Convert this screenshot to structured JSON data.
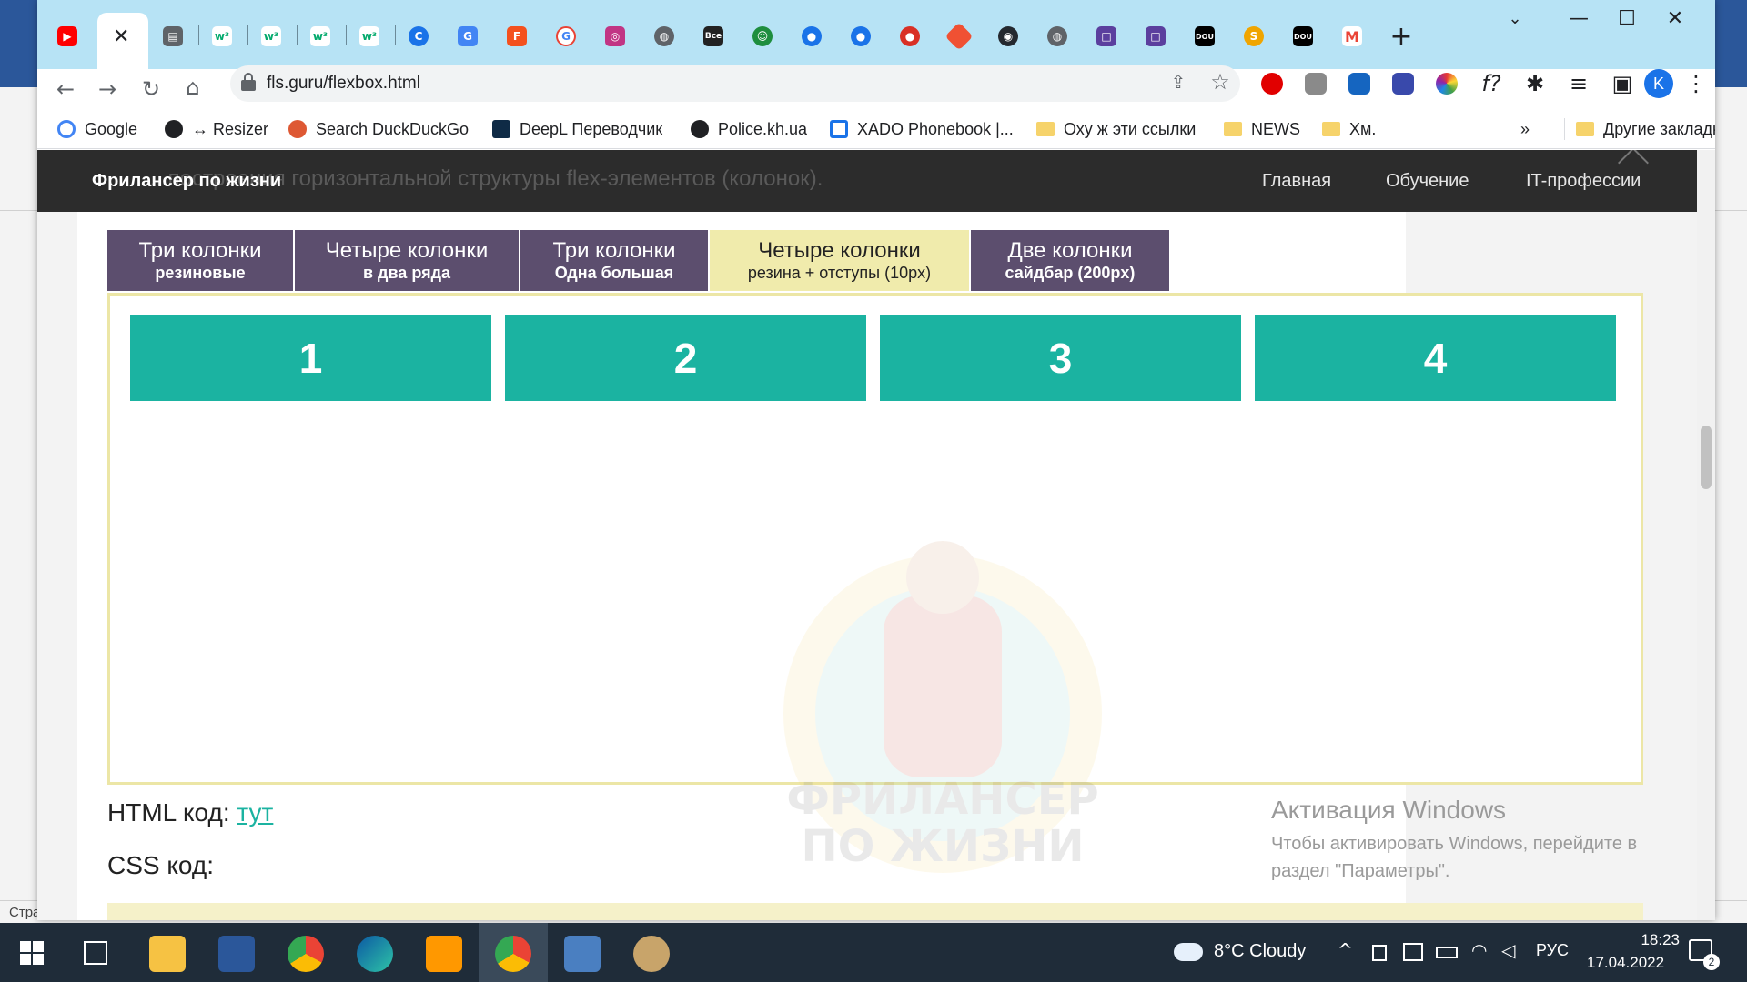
{
  "window": {
    "url": "fls.guru/flexbox.html"
  },
  "bookmarks": [
    {
      "label": "Google"
    },
    {
      "label": "↔ Resizer"
    },
    {
      "label": "Search DuckDuckGo"
    },
    {
      "label": "DeepL Переводчик"
    },
    {
      "label": "Police.kh.ua"
    },
    {
      "label": "XADO Phonebook |..."
    },
    {
      "label": "Оху ж эти ссылки"
    },
    {
      "label": "NEWS"
    },
    {
      "label": "Хм."
    }
  ],
  "bookmarks_more": "»",
  "bookmarks_other": "Другие закладки",
  "profile_initial": "K",
  "site": {
    "name": "Фрилансер по жизни",
    "ghost_text": "... построения горизонтальной структуры flex-элементов (колонок).",
    "nav": [
      "Главная",
      "Обучение",
      "IT-профессии"
    ]
  },
  "demo_tabs": [
    {
      "title": "Три колонки",
      "subtitle": "резиновые",
      "active": false
    },
    {
      "title": "Четыре колонки",
      "subtitle": "в два ряда",
      "active": false
    },
    {
      "title": "Три колонки",
      "subtitle": "Одна большая",
      "active": false
    },
    {
      "title": "Четыре колонки",
      "subtitle": "резина + отступы (10px)",
      "active": true
    },
    {
      "title": "Две колонки",
      "subtitle": "сайдбар (200px)",
      "active": false
    }
  ],
  "flex_items": [
    "1",
    "2",
    "3",
    "4"
  ],
  "watermark_text": [
    "ФРИЛАНСЕР",
    "ПО ЖИЗНИ"
  ],
  "html_code": {
    "label": "HTML код:",
    "link": "тут"
  },
  "css_code": {
    "label": "CSS код:"
  },
  "activation": {
    "title": "Активация Windows",
    "line1": "Чтобы активировать Windows, перейдите в",
    "line2": "раздел \"Параметры\"."
  },
  "word": {
    "status_left": "Стра"
  },
  "taskbar": {
    "weather": "8°C  Cloudy",
    "lang": "РУС",
    "time": "18:23",
    "date": "17.04.2022",
    "notifications": "2"
  },
  "colors": {
    "accent_teal": "#1bb3a1",
    "tab_purple": "#5c4e6e",
    "tab_active": "#f0ebac",
    "tabstrip": "#b7e3f5"
  }
}
